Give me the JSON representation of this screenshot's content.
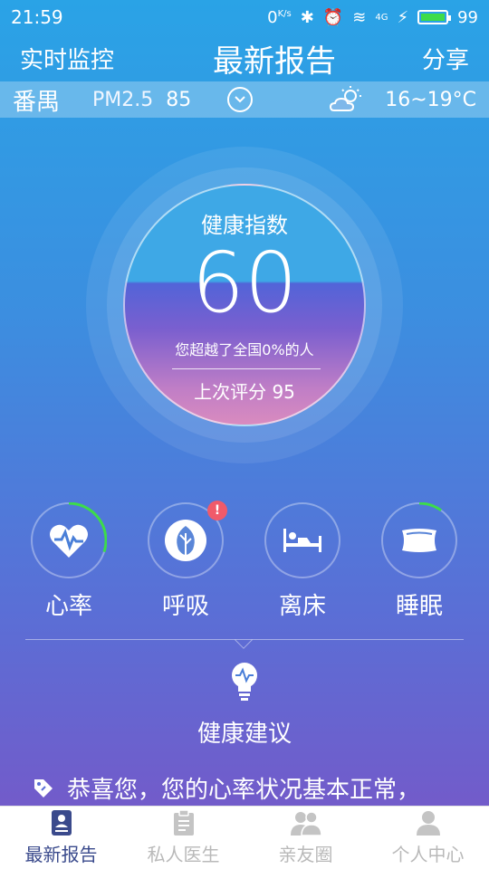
{
  "status_bar": {
    "time": "21:59",
    "net_speed": "0",
    "net_unit": "K/s",
    "signal": "4G",
    "battery": "99"
  },
  "nav": {
    "left": "实时监控",
    "title": "最新报告",
    "right": "分享"
  },
  "env": {
    "city": "番禺",
    "pm_label": "PM2.5",
    "pm_value": "85",
    "temperature": "16~19°C"
  },
  "gauge": {
    "title": "健康指数",
    "value": "60",
    "desc": "您超越了全国0%的人",
    "prev": "上次评分 95"
  },
  "metrics": [
    {
      "label": "心率",
      "icon": "heart-rate-icon",
      "progress": 0.3
    },
    {
      "label": "呼吸",
      "icon": "leaf-icon",
      "progress": 0.0,
      "alert": "!"
    },
    {
      "label": "离床",
      "icon": "bed-icon",
      "progress": 0.0
    },
    {
      "label": "睡眠",
      "icon": "pillow-icon",
      "progress": 0.1
    }
  ],
  "advice": {
    "title": "健康建议",
    "text": "恭喜您，您的心率状况基本正常，"
  },
  "tabs": [
    {
      "label": "最新报告",
      "active": true
    },
    {
      "label": "私人医生",
      "active": false
    },
    {
      "label": "亲友圈",
      "active": false
    },
    {
      "label": "个人中心",
      "active": false
    }
  ],
  "colors": {
    "accent_green": "#3ddc4a",
    "alert_red": "#f05a6a",
    "tab_active": "#3a4a8c",
    "tab_inactive": "#b9b9b9"
  }
}
